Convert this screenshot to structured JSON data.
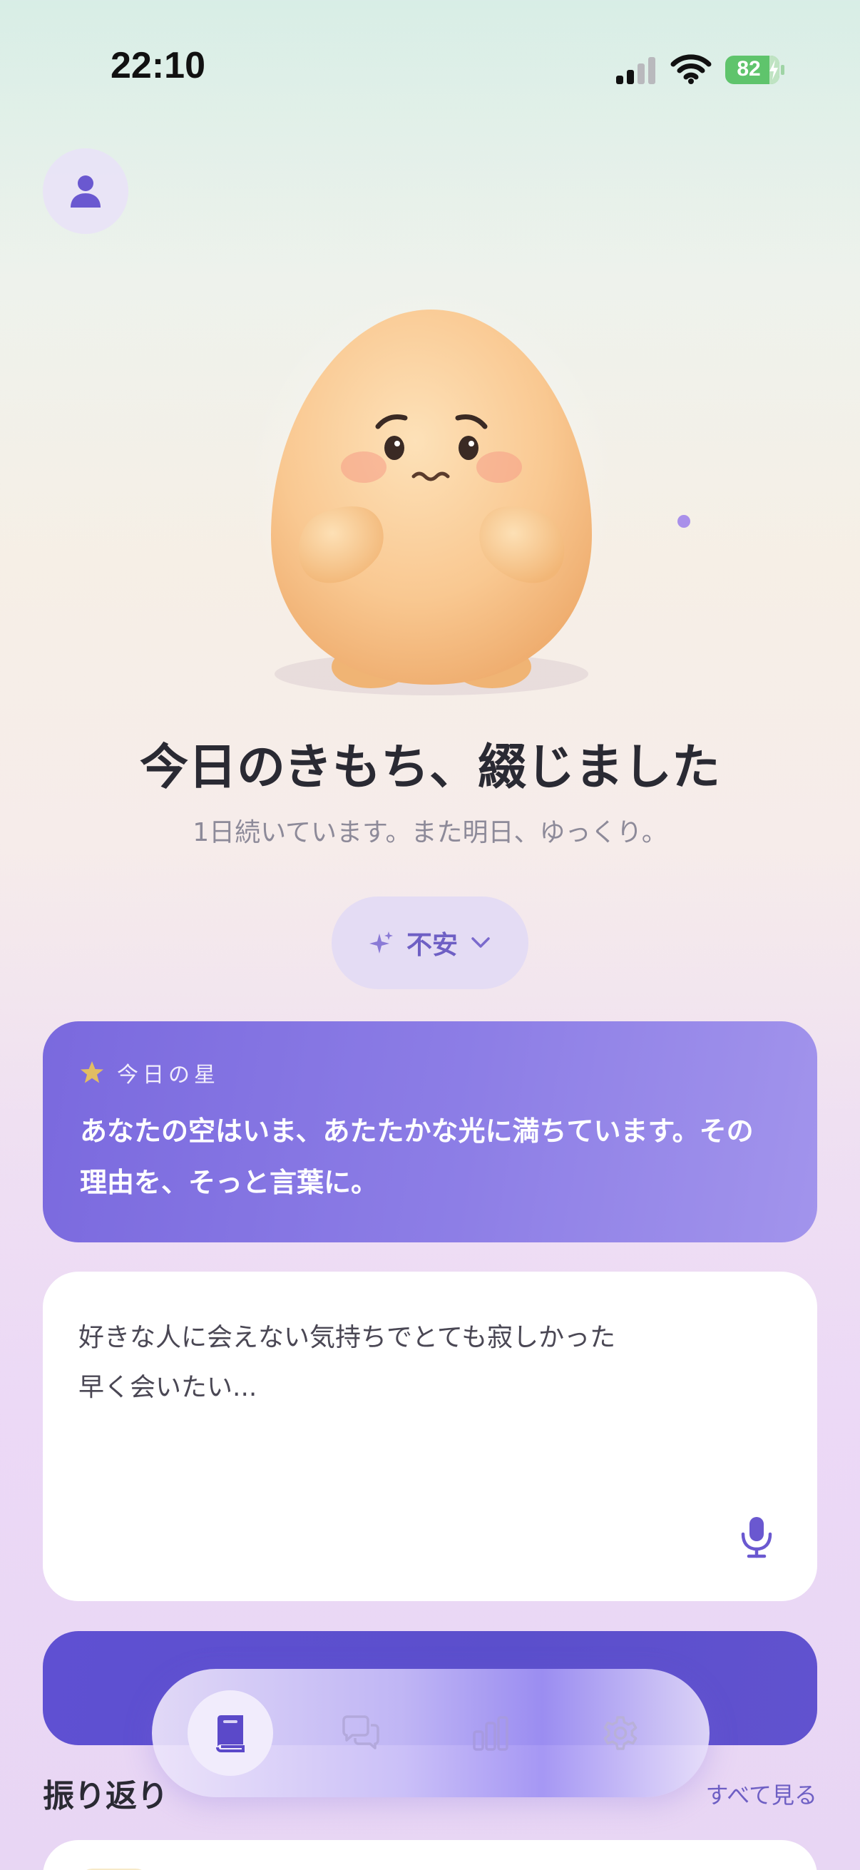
{
  "status_bar": {
    "time": "22:10",
    "battery_percent": "82",
    "battery_level": 0.82,
    "battery_color": "#5fc46c"
  },
  "header": {
    "profile_icon": "person-icon"
  },
  "hero": {
    "title": "今日のきもち、綴じました",
    "subtitle": "1日続いています。また明日、ゆっくり。"
  },
  "mood_selector": {
    "label": "不安",
    "icon": "sparkles-icon"
  },
  "star_card": {
    "label": "今日の星",
    "message": "あなたの空はいま、あたたかな光に満ちています。その理由を、そっと言葉に。",
    "accent_color": "#7a69de"
  },
  "entry": {
    "text": "好きな人に会えない気持ちでとても寂しかった\n早く会いたい...",
    "mic_icon": "microphone-icon"
  },
  "review": {
    "title": "振り返り",
    "see_all": "すべて見る"
  },
  "tab_bar": {
    "tabs": [
      {
        "name": "journal",
        "icon": "book-icon",
        "active": true
      },
      {
        "name": "chat",
        "icon": "chat-bubbles-icon",
        "active": false
      },
      {
        "name": "stats",
        "icon": "bar-chart-icon",
        "active": false
      },
      {
        "name": "settings",
        "icon": "gear-icon",
        "active": false
      }
    ]
  },
  "colors": {
    "primary": "#6e5fc4",
    "button": "#5f50d2"
  }
}
